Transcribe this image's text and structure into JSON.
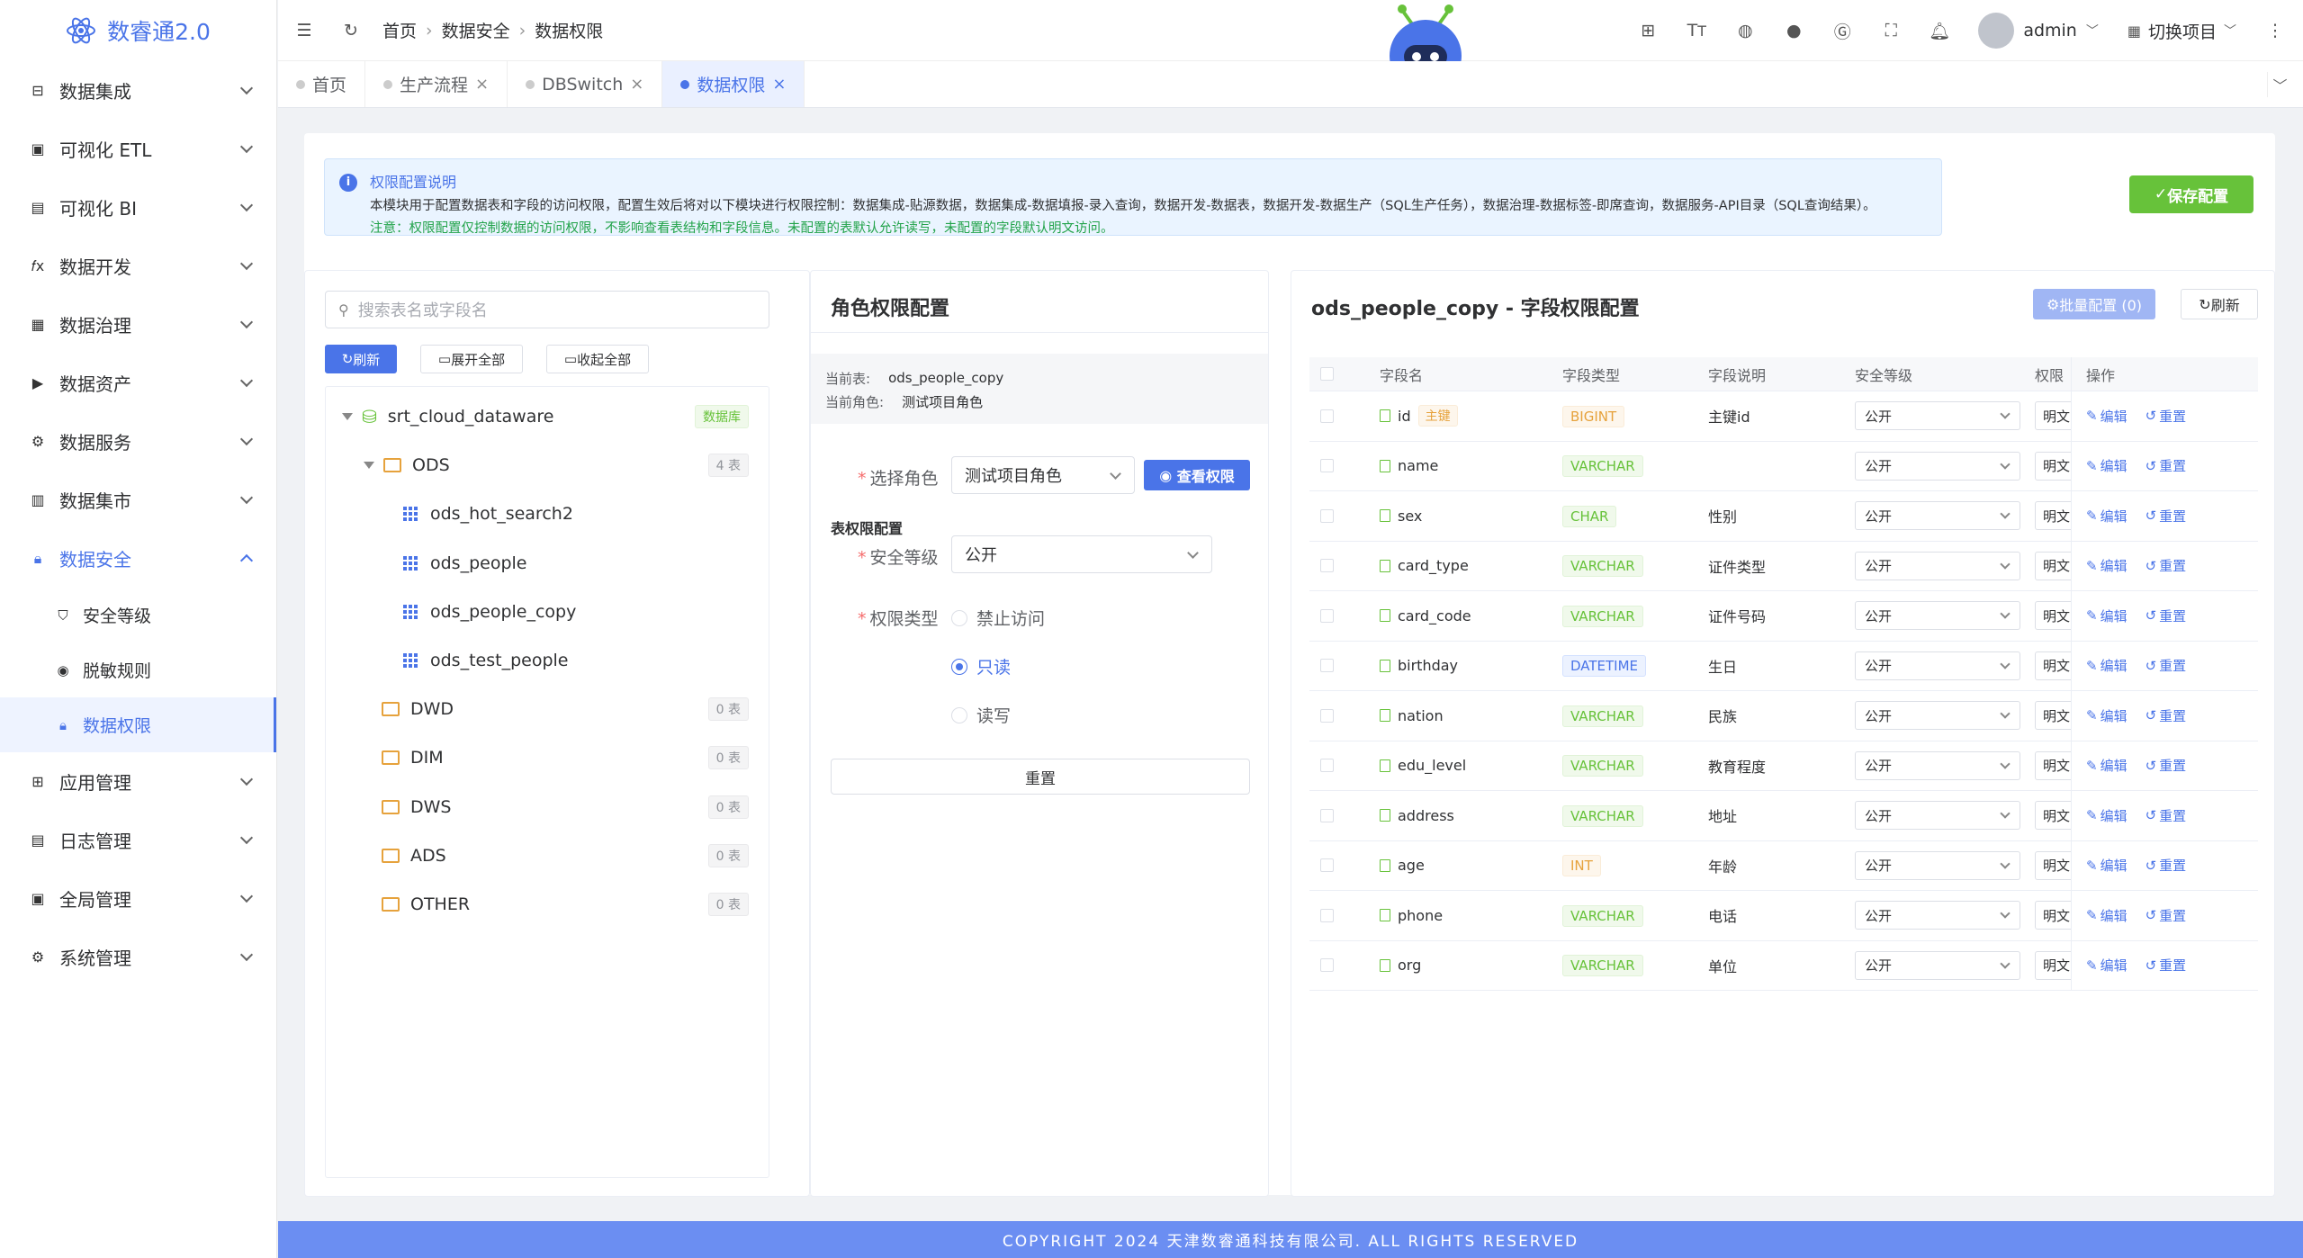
{
  "app": {
    "title": "数睿通2.0"
  },
  "sidebar": {
    "items": [
      {
        "label": "数据集成",
        "icon": "integration-icon"
      },
      {
        "label": "可视化 ETL",
        "icon": "etl-icon"
      },
      {
        "label": "可视化 BI",
        "icon": "bi-chart-icon"
      },
      {
        "label": "数据开发",
        "icon": "fx-icon"
      },
      {
        "label": "数据治理",
        "icon": "grid-icon"
      },
      {
        "label": "数据资产",
        "icon": "terminal-icon"
      },
      {
        "label": "数据服务",
        "icon": "service-icon"
      },
      {
        "label": "数据集市",
        "icon": "market-icon"
      },
      {
        "label": "数据安全",
        "icon": "lock-icon"
      }
    ],
    "sub_items": [
      {
        "label": "安全等级",
        "icon": "shield-icon"
      },
      {
        "label": "脱敏规则",
        "icon": "eye-icon"
      },
      {
        "label": "数据权限",
        "icon": "lock-icon"
      }
    ],
    "items_after": [
      {
        "label": "应用管理",
        "icon": "apps-icon"
      },
      {
        "label": "日志管理",
        "icon": "log-icon"
      },
      {
        "label": "全局管理",
        "icon": "global-icon"
      },
      {
        "label": "系统管理",
        "icon": "settings-icon"
      }
    ]
  },
  "header": {
    "breadcrumb": [
      "首页",
      "数据安全",
      "数据权限"
    ],
    "user": "admin",
    "switch_project": "切换项目"
  },
  "tabs": [
    {
      "label": "首页",
      "closable": false
    },
    {
      "label": "生产流程",
      "closable": true
    },
    {
      "label": "DBSwitch",
      "closable": true
    },
    {
      "label": "数据权限",
      "closable": true,
      "active": true
    }
  ],
  "notice": {
    "title": "权限配置说明",
    "desc": "本模块用于配置数据表和字段的访问权限，配置生效后将对以下模块进行权限控制：数据集成-贴源数据，数据集成-数据填报-录入查询，数据开发-数据表，数据开发-数据生产（SQL生产任务），数据治理-数据标签-即席查询，数据服务-API目录（SQL查询结果）。",
    "note": "注意：权限配置仅控制数据的访问权限，不影响查看表结构和字段信息。未配置的表默认允许读写，未配置的字段默认明文访问。",
    "save_label": "保存配置"
  },
  "tree_panel": {
    "search_placeholder": "搜索表名或字段名",
    "refresh": "刷新",
    "expand_all": "展开全部",
    "collapse_all": "收起全部",
    "root": {
      "label": "srt_cloud_dataware",
      "badge": "数据库"
    },
    "ods": {
      "label": "ODS",
      "badge": "4 表"
    },
    "tables": [
      "ods_hot_search2",
      "ods_people",
      "ods_people_copy",
      "ods_test_people"
    ],
    "folders": [
      {
        "label": "DWD",
        "badge": "0 表"
      },
      {
        "label": "DIM",
        "badge": "0 表"
      },
      {
        "label": "DWS",
        "badge": "0 表"
      },
      {
        "label": "ADS",
        "badge": "0 表"
      },
      {
        "label": "OTHER",
        "badge": "0 表"
      }
    ]
  },
  "role_panel": {
    "title": "角色权限配置",
    "current_table_label": "当前表:",
    "current_table": "ods_people_copy",
    "current_role_label": "当前角色:",
    "current_role": "测试项目角色",
    "select_role_label": "选择角色",
    "select_role_value": "测试项目角色",
    "view_perm": "查看权限",
    "table_section": "表权限配置",
    "security_level_label": "安全等级",
    "security_level_value": "公开",
    "perm_type_label": "权限类型",
    "perm_options": [
      "禁止访问",
      "只读",
      "读写"
    ],
    "perm_selected": "只读",
    "reset": "重置"
  },
  "field_panel": {
    "title": "ods_people_copy - 字段权限配置",
    "batch": "批量配置 (0)",
    "refresh": "刷新",
    "headers": [
      "字段名",
      "字段类型",
      "字段说明",
      "安全等级",
      "权限",
      "操作"
    ],
    "pk_tag": "主键",
    "edit": "编辑",
    "reset": "重置",
    "rows": [
      {
        "name": "id",
        "pk": true,
        "type": "BIGINT",
        "type_color": "orange",
        "desc": "主键id",
        "level": "公开",
        "mask": "明文"
      },
      {
        "name": "name",
        "pk": false,
        "type": "VARCHAR",
        "type_color": "green",
        "desc": "",
        "level": "公开",
        "mask": "明文"
      },
      {
        "name": "sex",
        "pk": false,
        "type": "CHAR",
        "type_color": "green",
        "desc": "性别",
        "level": "公开",
        "mask": "明文"
      },
      {
        "name": "card_type",
        "pk": false,
        "type": "VARCHAR",
        "type_color": "green",
        "desc": "证件类型",
        "level": "公开",
        "mask": "明文"
      },
      {
        "name": "card_code",
        "pk": false,
        "type": "VARCHAR",
        "type_color": "green",
        "desc": "证件号码",
        "level": "公开",
        "mask": "明文"
      },
      {
        "name": "birthday",
        "pk": false,
        "type": "DATETIME",
        "type_color": "blue",
        "desc": "生日",
        "level": "公开",
        "mask": "明文"
      },
      {
        "name": "nation",
        "pk": false,
        "type": "VARCHAR",
        "type_color": "green",
        "desc": "民族",
        "level": "公开",
        "mask": "明文"
      },
      {
        "name": "edu_level",
        "pk": false,
        "type": "VARCHAR",
        "type_color": "green",
        "desc": "教育程度",
        "level": "公开",
        "mask": "明文"
      },
      {
        "name": "address",
        "pk": false,
        "type": "VARCHAR",
        "type_color": "green",
        "desc": "地址",
        "level": "公开",
        "mask": "明文"
      },
      {
        "name": "age",
        "pk": false,
        "type": "INT",
        "type_color": "orange",
        "desc": "年龄",
        "level": "公开",
        "mask": "明文"
      },
      {
        "name": "phone",
        "pk": false,
        "type": "VARCHAR",
        "type_color": "green",
        "desc": "电话",
        "level": "公开",
        "mask": "明文"
      },
      {
        "name": "org",
        "pk": false,
        "type": "VARCHAR",
        "type_color": "green",
        "desc": "单位",
        "level": "公开",
        "mask": "明文"
      }
    ]
  },
  "footer": "COPYRIGHT 2024 天津数睿通科技有限公司. ALL RIGHTS RESERVED",
  "colors": {
    "primary": "#4a74e8",
    "success": "#67c23a",
    "warning": "#e6a23c"
  }
}
